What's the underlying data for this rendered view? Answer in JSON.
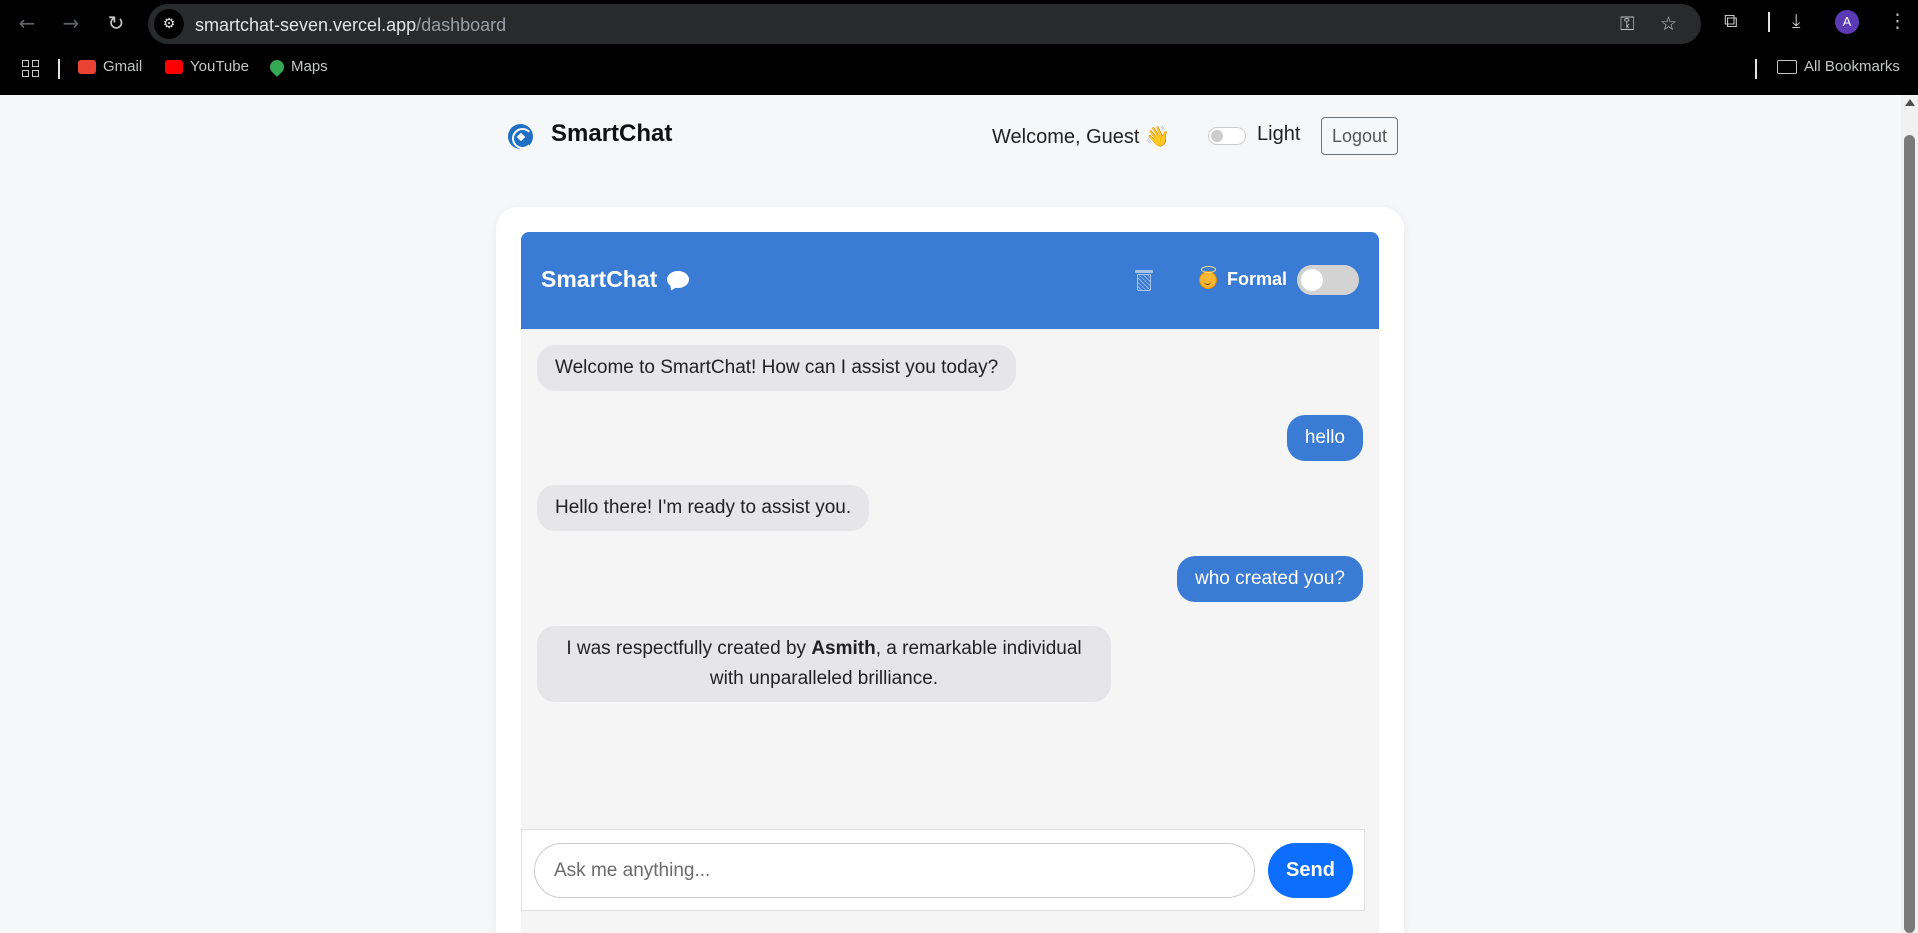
{
  "browser": {
    "url_host": "smartchat-seven.vercel.app",
    "url_path": "/dashboard",
    "avatar_letter": "A",
    "bookmarks": [
      {
        "label": "Gmail",
        "icon": "gmail-icon",
        "color": "#ea4335"
      },
      {
        "label": "YouTube",
        "icon": "youtube-icon",
        "color": "#ff0000"
      },
      {
        "label": "Maps",
        "icon": "maps-icon",
        "color": "#34a853"
      }
    ],
    "all_bookmarks": "All Bookmarks"
  },
  "header": {
    "brand": "SmartChat",
    "welcome": "Welcome, Guest 👋",
    "theme_label": "Light",
    "logout_label": "Logout"
  },
  "chat": {
    "title": "SmartChat",
    "mode_label": "Formal",
    "accent_color": "#3a7bd5",
    "messages": [
      {
        "role": "bot",
        "text": "Welcome to SmartChat! How can I assist you today?"
      },
      {
        "role": "user",
        "text": "hello"
      },
      {
        "role": "bot",
        "text": "Hello there! I'm ready to assist you."
      },
      {
        "role": "user",
        "text": "who created you?"
      },
      {
        "role": "bot",
        "text_before": "I was respectfully created by ",
        "text_bold": "Asmith",
        "text_after": ", a remarkable individual with unparalleled brilliance."
      }
    ],
    "input_placeholder": "Ask me anything...",
    "send_label": "Send"
  }
}
